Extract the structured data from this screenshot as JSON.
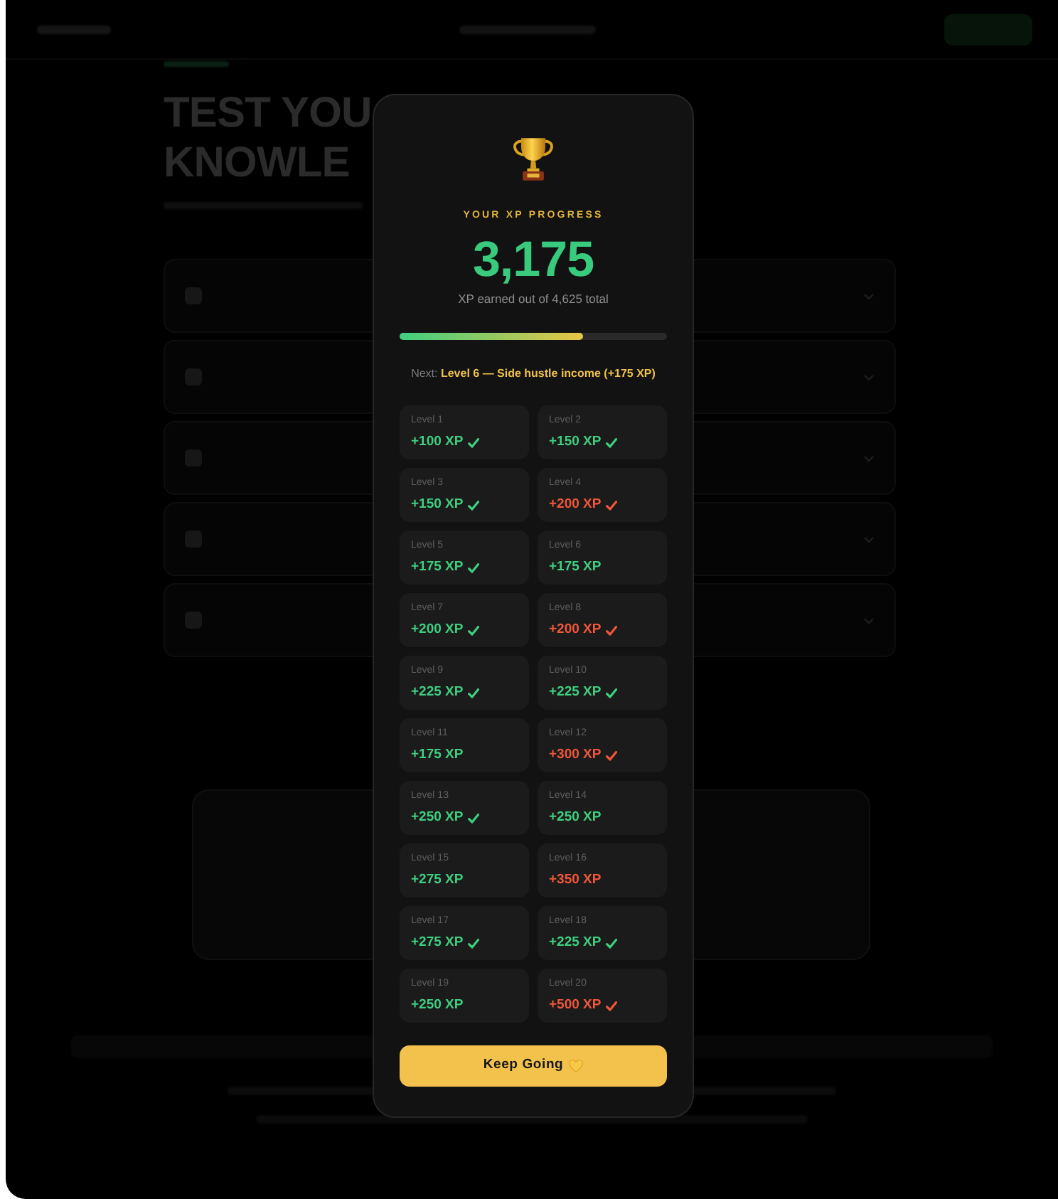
{
  "background_page": {
    "headline_lines": [
      "TEST YOU",
      "KNOWLE"
    ]
  },
  "modal": {
    "title": "YOUR XP PROGRESS",
    "xp_total": "3,175",
    "subtitle": "XP earned out of 4,625 total",
    "progress": {
      "level": 0.686
    },
    "next": "Next: **Level 6 — Side hustle income (+175 XP)**",
    "levels": [
      {
        "label": "Level 1",
        "xp": "+100 XP",
        "color": "#3ecf80",
        "checked": true
      },
      {
        "label": "Level 2",
        "xp": "+150 XP",
        "color": "#3ecf80",
        "checked": true
      },
      {
        "label": "Level 3",
        "xp": "+150 XP",
        "color": "#3ecf80",
        "checked": true
      },
      {
        "label": "Level 4",
        "xp": "+200 XP",
        "color": "#f0573a",
        "checked": true
      },
      {
        "label": "Level 5",
        "xp": "+175 XP",
        "color": "#3ecf80",
        "checked": true
      },
      {
        "label": "Level 6",
        "xp": "+175 XP",
        "color": "#3ecf80",
        "checked": false
      },
      {
        "label": "Level 7",
        "xp": "+200 XP",
        "color": "#3ecf80",
        "checked": true
      },
      {
        "label": "Level 8",
        "xp": "+200 XP",
        "color": "#f0573a",
        "checked": true
      },
      {
        "label": "Level 9",
        "xp": "+225 XP",
        "color": "#3ecf80",
        "checked": true
      },
      {
        "label": "Level 10",
        "xp": "+225 XP",
        "color": "#3ecf80",
        "checked": true
      },
      {
        "label": "Level 11",
        "xp": "+175 XP",
        "color": "#3ecf80",
        "checked": false
      },
      {
        "label": "Level 12",
        "xp": "+300 XP",
        "color": "#f0573a",
        "checked": true
      },
      {
        "label": "Level 13",
        "xp": "+250 XP",
        "color": "#3ecf80",
        "checked": true
      },
      {
        "label": "Level 14",
        "xp": "+250 XP",
        "color": "#3ecf80",
        "checked": false
      },
      {
        "label": "Level 15",
        "xp": "+275 XP",
        "color": "#3ecf80",
        "checked": false
      },
      {
        "label": "Level 16",
        "xp": "+350 XP",
        "color": "#f0573a",
        "checked": false
      },
      {
        "label": "Level 17",
        "xp": "+275 XP",
        "color": "#3ecf80",
        "checked": true
      },
      {
        "label": "Level 18",
        "xp": "+225 XP",
        "color": "#3ecf80",
        "checked": true
      },
      {
        "label": "Level 19",
        "xp": "+250 XP",
        "color": "#3ecf80",
        "checked": false
      },
      {
        "label": "Level 20",
        "xp": "+500 XP",
        "color": "#f0573a",
        "checked": true
      }
    ],
    "button": {
      "label": "Keep Going"
    }
  }
}
